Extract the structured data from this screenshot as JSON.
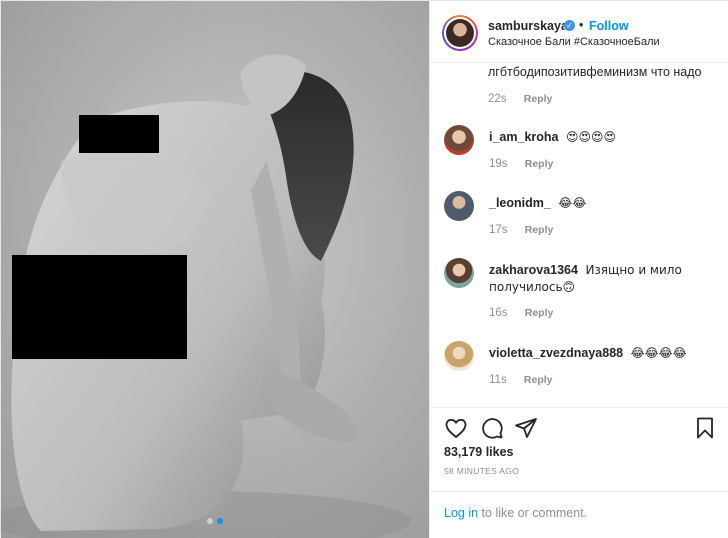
{
  "post": {
    "username": "samburskaya",
    "separator": "•",
    "follow_label": "Follow",
    "location": "Сказочное Бали #СказочноеБали",
    "verified_icon": "check-icon"
  },
  "comments": {
    "continued": {
      "text": "лгбтбодипозитивфеминизм что надо",
      "age": "22s",
      "reply": "Reply"
    },
    "items": [
      {
        "user": "i_am_kroha",
        "text": "😍😍😍😍",
        "age": "19s",
        "reply": "Reply"
      },
      {
        "user": "_leonidm_",
        "text": "😂😂",
        "age": "17s",
        "reply": "Reply"
      },
      {
        "user": "zakharova1364",
        "text": "Изящно и мило получилось🙃",
        "age": "16s",
        "reply": "Reply"
      },
      {
        "user": "violetta_zvezdnaya888",
        "text": "😂😂😂😂",
        "age": "11s",
        "reply": "Reply"
      }
    ]
  },
  "actions": {
    "likes": "83,179 likes",
    "time": "58 MINUTES AGO"
  },
  "footer": {
    "login": "Log in",
    "rest": "to like or comment."
  },
  "colors": {
    "accent": "#0095f6",
    "muted": "#8e8e8e",
    "text": "#262626"
  }
}
